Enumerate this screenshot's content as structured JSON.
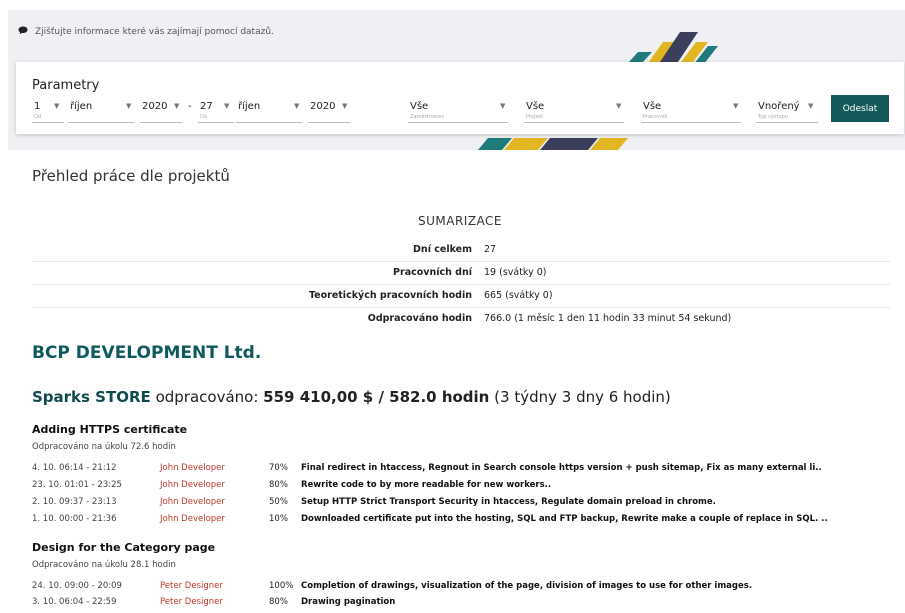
{
  "banner": {
    "text": "Zjišťujte informace které vás zajímají pomocí datazů."
  },
  "filter": {
    "title": "Parametry",
    "from_day": "1",
    "from_day_caption": "Od",
    "from_month": "říjen",
    "from_year": "2020",
    "to_day": "27",
    "to_day_caption": "Do",
    "to_month": "říjen",
    "to_year": "2020",
    "employee": "Vše",
    "employee_caption": "Zaměstnanec",
    "project": "Vše",
    "project_caption": "Projekt",
    "task": "Vše",
    "task_caption": "Pracovník",
    "output": "Vnořený",
    "output_caption": "Typ výstupu",
    "submit": "Odeslat",
    "dash": "-"
  },
  "main": {
    "title": "Přehled práce dle projektů",
    "summary": {
      "title": "SUMARIZACE",
      "rows": [
        {
          "label": "Dní celkem",
          "value": "27"
        },
        {
          "label": "Pracovních dní",
          "value": "19 (svátky 0)"
        },
        {
          "label": "Teoretických pracovních hodin",
          "value": "665 (svátky 0)"
        },
        {
          "label": "Odpracováno hodin",
          "value": "766.0 (1 měsíc 1 den 11 hodin 33 minut 54 sekund)"
        }
      ]
    },
    "company": "BCP DEVELOPMENT Ltd.",
    "project": {
      "name": "Sparks STORE",
      "worked_label": "odpracováno:",
      "amount": "559 410,00 $ / 582.0 hodin",
      "duration": "(3 týdny 3 dny 6 hodin)"
    },
    "tasks": [
      {
        "title": "Adding HTTPS certificate",
        "subtitle": "Odpracováno na úkolu 72.6 hodin",
        "logs": [
          {
            "date": "4. 10. 06:14 - 21:12",
            "user": "John Developer",
            "pct": "70%",
            "text": "Final redirect in htaccess, Regnout in Search console https version + push sitemap, Fix as many external li.."
          },
          {
            "date": "23. 10. 01:01 - 23:25",
            "user": "John Developer",
            "pct": "80%",
            "text": "Rewrite code to by more readable for new workers.."
          },
          {
            "date": "2. 10. 09:37 - 23:13",
            "user": "John Developer",
            "pct": "50%",
            "text": "Setup HTTP Strict Transport Security in htaccess, Regulate domain preload in chrome."
          },
          {
            "date": "1. 10. 00:00 - 21:36",
            "user": "John Developer",
            "pct": "10%",
            "text": "Downloaded certificate put into the hosting, SQL and FTP backup, Rewrite make a couple of replace in SQL. .."
          }
        ]
      },
      {
        "title": "Design for the Category page",
        "subtitle": "Odpracováno na úkolu 28.1 hodin",
        "logs": [
          {
            "date": "24. 10. 09:00 - 20:09",
            "user": "Peter Designer",
            "pct": "100%",
            "text": "Completion of drawings, visualization of the page, division of images to use for other images."
          },
          {
            "date": "3. 10. 06:04 - 22:59",
            "user": "Peter Designer",
            "pct": "80%",
            "text": "Drawing pagination"
          }
        ]
      }
    ]
  },
  "colors": {
    "accent": "#15595a",
    "user": "#c0392b",
    "company": "#0f5a5c"
  },
  "icons": {
    "banner": "chat-bubble-icon",
    "dropdown": "caret-down-icon"
  }
}
